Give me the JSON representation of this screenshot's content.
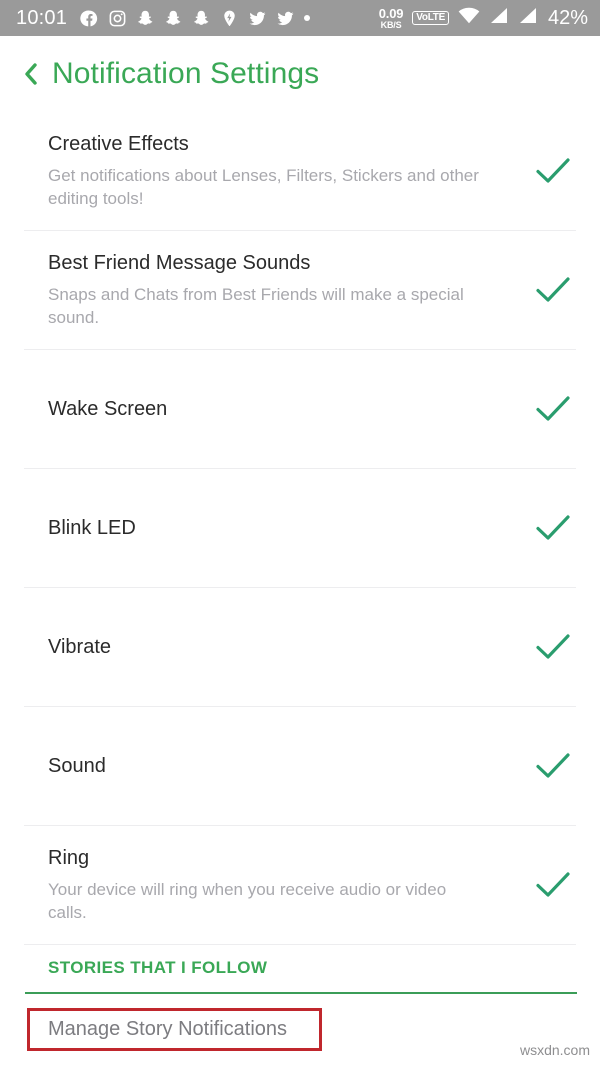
{
  "statusbar": {
    "clock": "10:01",
    "tray_icons": [
      "facebook-icon",
      "instagram-icon",
      "snapchat-icon",
      "snapchat-icon",
      "snapchat-icon",
      "snapchat-bolt-icon",
      "twitter-icon",
      "twitter-icon",
      "overflow-dot-icon"
    ],
    "net_speed_value": "0.09",
    "net_speed_unit": "KB/S",
    "volte_label": "VoLTE",
    "right_icons": [
      "wifi-icon",
      "signal-icon",
      "signal-icon"
    ],
    "battery": "42%",
    "bg_color": "#9a9a9a"
  },
  "header": {
    "back_label": "‹",
    "title": "Notification Settings",
    "accent_color": "#3aa856"
  },
  "settings": {
    "items": [
      {
        "title": "Creative Effects",
        "subtitle": "Get notifications about Lenses, Filters, Stickers and other editing tools!",
        "checked": true
      },
      {
        "title": "Best Friend Message Sounds",
        "subtitle": "Snaps and Chats from Best Friends will make a special sound.",
        "checked": true
      },
      {
        "title": "Wake Screen",
        "subtitle": "",
        "checked": true
      },
      {
        "title": "Blink LED",
        "subtitle": "",
        "checked": true
      },
      {
        "title": "Vibrate",
        "subtitle": "",
        "checked": true
      },
      {
        "title": "Sound",
        "subtitle": "",
        "checked": true
      },
      {
        "title": "Ring",
        "subtitle": "Your device will ring when you receive audio or video calls.",
        "checked": true
      }
    ],
    "check_color": "#2a9d6e"
  },
  "stories_section": {
    "header": "STORIES THAT I FOLLOW",
    "manage_label": "Manage Story Notifications",
    "rule_color": "#3b9d58",
    "highlight_color": "#c0272d"
  },
  "watermark": "wsxdn.com"
}
